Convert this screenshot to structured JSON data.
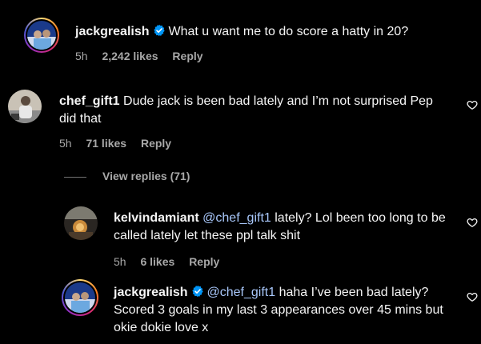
{
  "colors": {
    "background": "#000000",
    "text": "#f5f5f5",
    "muted": "#a8a8a8",
    "mention": "#a8c7fa",
    "verified": "#0095f6"
  },
  "comments": [
    {
      "username": "jackgrealish",
      "verified": true,
      "mention": "",
      "text": "What u want me to do score a hatty in 20?",
      "time": "5h",
      "likes": "2,242 likes",
      "reply": "Reply"
    },
    {
      "username": "chef_gift1",
      "verified": false,
      "mention": "",
      "text": "Dude jack is been bad lately and I’m not surprised Pep did that",
      "time": "5h",
      "likes": "71 likes",
      "reply": "Reply"
    },
    {
      "username": "kelvindamiant",
      "verified": false,
      "mention": "@chef_gift1",
      "text": "lately? Lol been too long to be called lately let these ppl talk shit",
      "time": "5h",
      "likes": "6 likes",
      "reply": "Reply"
    },
    {
      "username": "jackgrealish",
      "verified": true,
      "mention": "@chef_gift1",
      "text": "haha I’ve been bad lately? Scored 3 goals in my last 3 appearances over 45 mins but okie dokie love x",
      "time": "",
      "likes": "",
      "reply": ""
    }
  ],
  "view_replies": "View replies (71)",
  "icons": {
    "verified": "verified-badge-icon",
    "like": "heart-outline-icon"
  }
}
